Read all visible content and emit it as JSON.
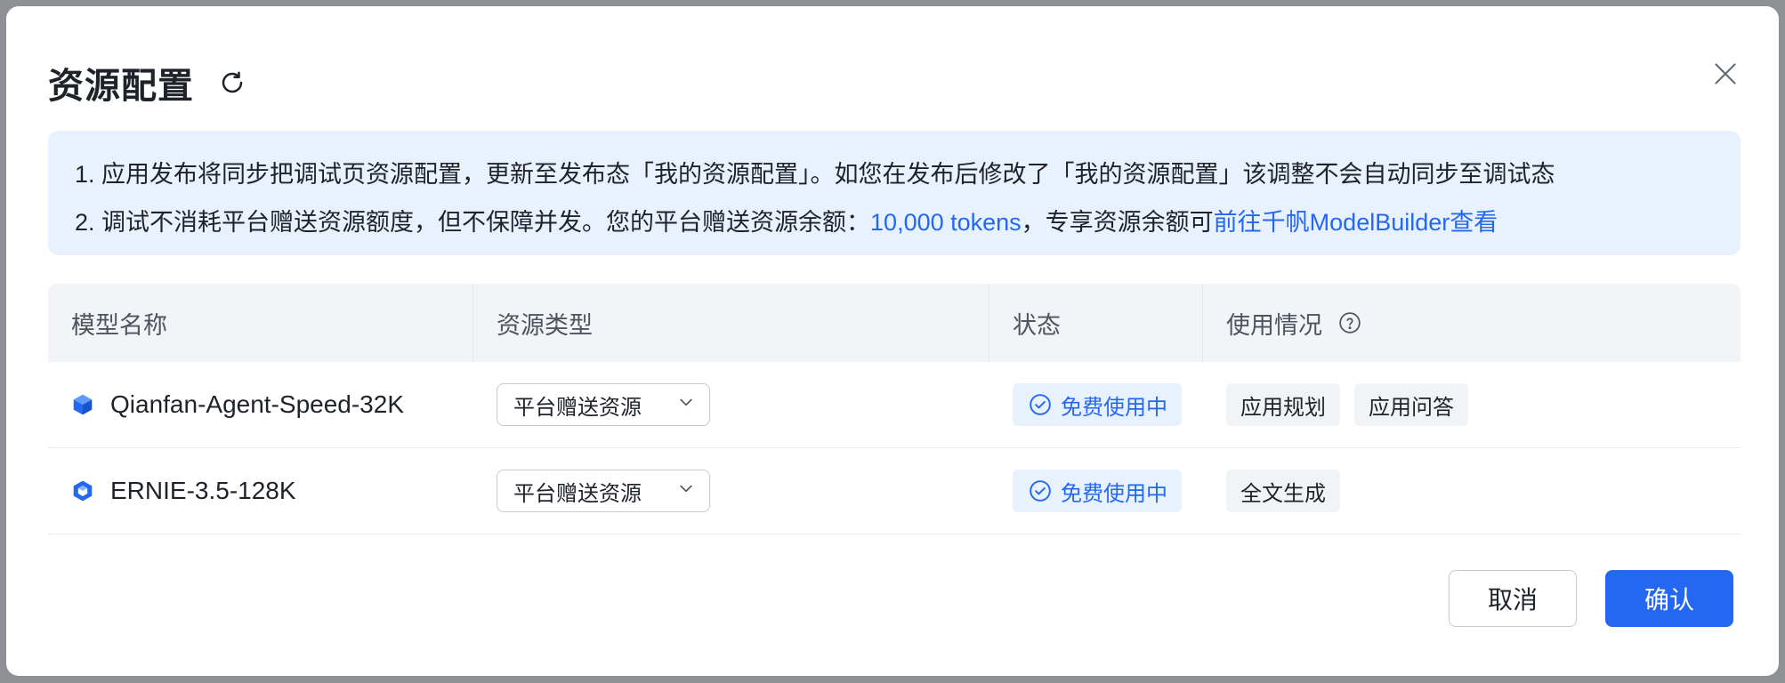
{
  "dialog": {
    "title": "资源配置",
    "refresh_icon": "refresh-icon",
    "close_icon": "close-icon"
  },
  "notice": {
    "line1": "1. 应用发布将同步把调试页资源配置，更新至发布态「我的资源配置」。如您在发布后修改了「我的资源配置」该调整不会自动同步至调试态",
    "line2_prefix": "2. 调试不消耗平台赠送资源额度，但不保障并发。您的平台赠送资源余额：",
    "line2_balance": "10,000 tokens",
    "line2_mid": "，专享资源余额可",
    "line2_link": "前往千帆ModelBuilder查看"
  },
  "table": {
    "headers": {
      "model_name": "模型名称",
      "resource_type": "资源类型",
      "status": "状态",
      "usage": "使用情况"
    },
    "rows": [
      {
        "model": "Qianfan-Agent-Speed-32K",
        "icon": "cube-icon",
        "resource_type": "平台赠送资源",
        "status": "免费使用中",
        "usage": [
          "应用规划",
          "应用问答"
        ]
      },
      {
        "model": "ERNIE-3.5-128K",
        "icon": "hexagon-cube-icon",
        "resource_type": "平台赠送资源",
        "status": "免费使用中",
        "usage": [
          "全文生成"
        ]
      }
    ]
  },
  "footer": {
    "cancel": "取消",
    "confirm": "确认"
  },
  "colors": {
    "primary": "#2468f2",
    "notice_bg": "#e8f1fe",
    "header_bg": "#f2f4f7",
    "tag_bg": "#f2f3f5"
  }
}
